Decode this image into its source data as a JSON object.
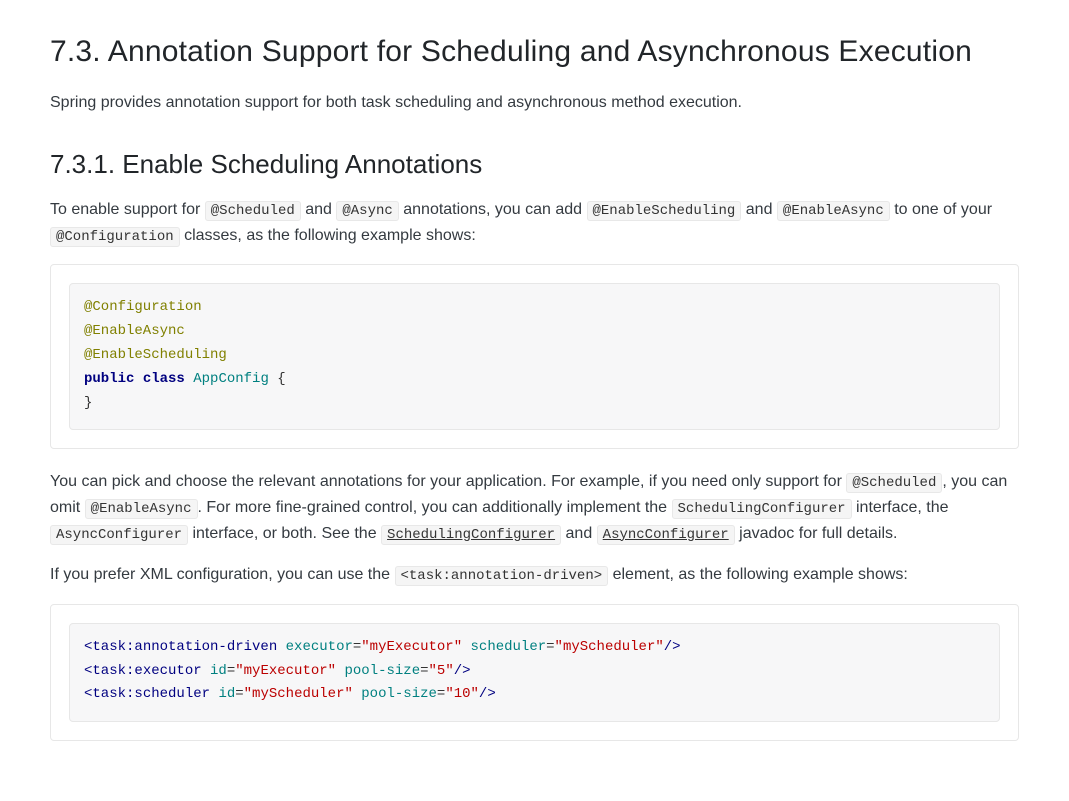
{
  "section": {
    "number": "7.3.",
    "title": "Annotation Support for Scheduling and Asynchronous Execution"
  },
  "intro": "Spring provides annotation support for both task scheduling and asynchronous method execution.",
  "subsection": {
    "number": "7.3.1.",
    "title": "Enable Scheduling Annotations"
  },
  "p1": {
    "t1": "To enable support for ",
    "c1": "@Scheduled",
    "t2": " and ",
    "c2": "@Async",
    "t3": " annotations, you can add ",
    "c3": "@EnableScheduling",
    "t4": " and ",
    "c4": "@EnableAsync",
    "t5": " to one of your ",
    "c5": "@Configuration",
    "t6": " classes, as the following example shows:"
  },
  "code1": {
    "a1": "@Configuration",
    "a2": "@EnableAsync",
    "a3": "@EnableScheduling",
    "kw_public": "public",
    "kw_class": "class",
    "type_name": "AppConfig",
    "brace_open": "{",
    "brace_close": "}"
  },
  "p2": {
    "t1": "You can pick and choose the relevant annotations for your application. For example, if you need only support for ",
    "c1": "@Scheduled",
    "t2": ", you can omit ",
    "c2": "@EnableAsync",
    "t3": ". For more fine-grained control, you can additionally implement the ",
    "c3": "SchedulingConfigurer",
    "t4": " interface, the ",
    "c4": "AsyncConfigurer",
    "t5": " interface, or both. See the ",
    "l1": "SchedulingConfigurer",
    "t6": " and ",
    "l2": "AsyncConfigurer",
    "t7": " javadoc for full details."
  },
  "p3": {
    "t1": "If you prefer XML configuration, you can use the ",
    "c1": "<task:annotation-driven>",
    "t2": " element, as the following example shows:"
  },
  "code2": {
    "l1": {
      "open": "<",
      "tag": "task:annotation-driven",
      "a1n": "executor",
      "eq": "=",
      "a1v": "\"myExecutor\"",
      "a2n": "scheduler",
      "a2v": "\"myScheduler\"",
      "close": "/>"
    },
    "l2": {
      "open": "<",
      "tag": "task:executor",
      "a1n": "id",
      "eq": "=",
      "a1v": "\"myExecutor\"",
      "a2n": "pool-size",
      "a2v": "\"5\"",
      "close": "/>"
    },
    "l3": {
      "open": "<",
      "tag": "task:scheduler",
      "a1n": "id",
      "eq": "=",
      "a1v": "\"myScheduler\"",
      "a2n": "pool-size",
      "a2v": "\"10\"",
      "close": "/>"
    }
  }
}
